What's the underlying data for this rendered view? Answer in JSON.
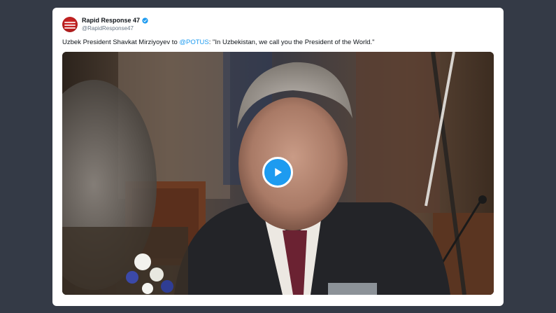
{
  "tweet": {
    "display_name": "Rapid Response 47",
    "handle": "@RapidResponse47",
    "text_before": "Uzbek President Shavkat Mirziyoyev to ",
    "mention": "@POTUS",
    "text_after": ": \"In Uzbekistan, we call you the President of the World.\"",
    "avatar_icon": "rapid-response-logo",
    "verified_icon": "verified-badge-icon",
    "media": {
      "type": "video",
      "play_icon": "play-icon"
    }
  },
  "colors": {
    "background": "#343a46",
    "card": "#ffffff",
    "accent": "#1d9bf0",
    "text": "#0f1419",
    "muted": "#687684",
    "avatar": "#c62020"
  }
}
